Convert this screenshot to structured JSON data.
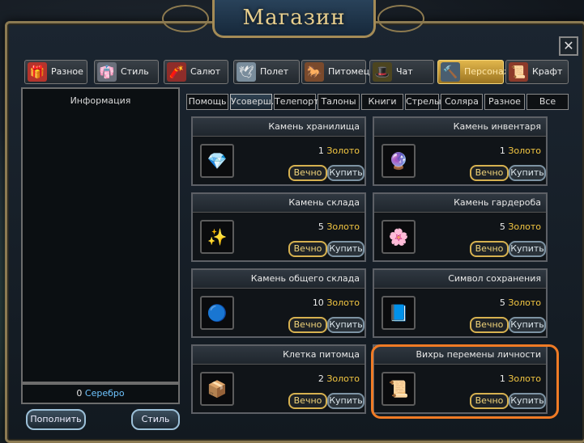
{
  "window": {
    "title": "Магазин"
  },
  "top_tabs": [
    {
      "label": "Разное",
      "icon": "gift-icon",
      "glyph": "🎁",
      "icon_bg": "#b5342c"
    },
    {
      "label": "Стиль",
      "icon": "costume-icon",
      "glyph": "👘",
      "icon_bg": "#6a6f7a"
    },
    {
      "label": "Салют",
      "icon": "firework-icon",
      "glyph": "🧨",
      "icon_bg": "#8e2d2a"
    },
    {
      "label": "Полет",
      "icon": "wing-icon",
      "glyph": "🕊",
      "icon_bg": "#7a8d9c"
    },
    {
      "label": "Питомец",
      "icon": "pet-icon",
      "glyph": "🐎",
      "icon_bg": "#7a4a2c"
    },
    {
      "label": "Чат",
      "icon": "chat-icon",
      "glyph": "🎩",
      "icon_bg": "#4c4520"
    },
    {
      "label": "Персонаж",
      "icon": "character-icon",
      "glyph": "🔨",
      "icon_bg": "#4a5e70",
      "active": true
    },
    {
      "label": "Крафт",
      "icon": "craft-icon",
      "glyph": "📜",
      "icon_bg": "#8c3a2a"
    }
  ],
  "filter_tabs": [
    {
      "label": "Помощь"
    },
    {
      "label": "Усоверш.",
      "active": true
    },
    {
      "label": "Телепорт"
    },
    {
      "label": "Талоны"
    },
    {
      "label": "Книги"
    },
    {
      "label": "Стрелы"
    },
    {
      "label": "Соляра"
    },
    {
      "label": "Разное"
    },
    {
      "label": "Все"
    }
  ],
  "info_panel": {
    "title": "Информация"
  },
  "balance": {
    "amount": "0",
    "currency": "Серебро"
  },
  "bottom_buttons": {
    "topup": "Пополнить",
    "style": "Стиль"
  },
  "items": [
    {
      "name": "Камень хранилища",
      "price": "1",
      "currency": "Золото",
      "period": "Вечно",
      "buy": "Купить",
      "icon": "storage-stone-icon",
      "glyph": "💎"
    },
    {
      "name": "Камень инвентаря",
      "price": "1",
      "currency": "Золото",
      "period": "Вечно",
      "buy": "Купить",
      "icon": "inventory-stone-icon",
      "glyph": "🔮"
    },
    {
      "name": "Камень склада",
      "price": "5",
      "currency": "Золото",
      "period": "Вечно",
      "buy": "Купить",
      "icon": "warehouse-stone-icon",
      "glyph": "✨"
    },
    {
      "name": "Камень гардероба",
      "price": "5",
      "currency": "Золото",
      "period": "Вечно",
      "buy": "Купить",
      "icon": "wardrobe-stone-icon",
      "glyph": "🌸"
    },
    {
      "name": "Камень общего склада",
      "price": "10",
      "currency": "Золото",
      "period": "Вечно",
      "buy": "Купить",
      "icon": "shared-warehouse-stone-icon",
      "glyph": "🔵"
    },
    {
      "name": "Символ сохранения",
      "price": "5",
      "currency": "Золото",
      "period": "Вечно",
      "buy": "Купить",
      "icon": "preservation-symbol-icon",
      "glyph": "📘"
    },
    {
      "name": "Клетка питомца",
      "price": "2",
      "currency": "Золото",
      "period": "Вечно",
      "buy": "Купить",
      "icon": "pet-cage-icon",
      "glyph": "📦"
    },
    {
      "name": "Вихрь перемены личности",
      "price": "1",
      "currency": "Золото",
      "period": "Вечно",
      "buy": "Купить",
      "icon": "identity-change-scroll-icon",
      "glyph": "📜"
    }
  ]
}
